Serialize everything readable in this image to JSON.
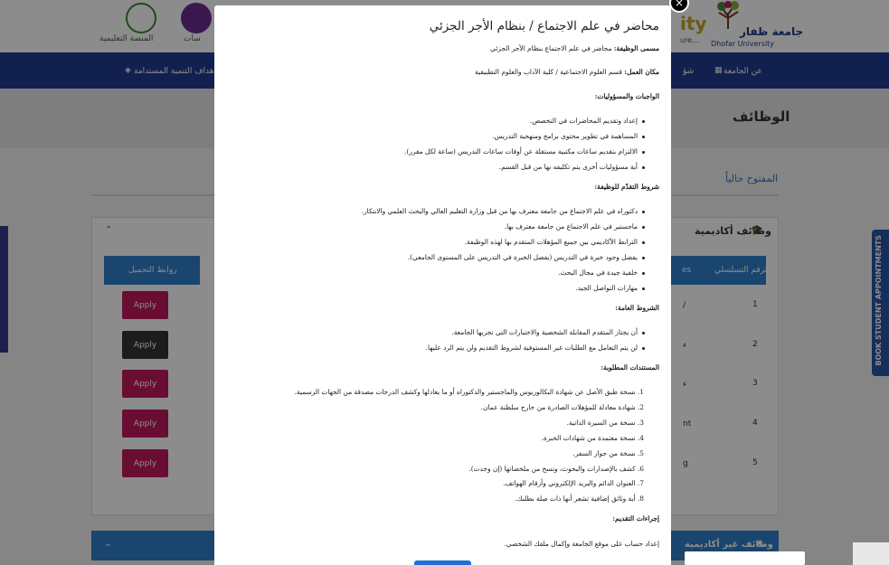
{
  "background": {
    "header": {
      "logo_text_ar": "جامعة ظفار",
      "logo_text_en": "Dhofar University",
      "logo_partial": "ity",
      "logo_partial_sub": "ure...",
      "app1_label": "المنصة التعليمية",
      "app2_label": "سات"
    },
    "nav": {
      "item1": "عن الجامعة",
      "item2": "شؤ",
      "item3": "أهداف التنمية المستدامة"
    },
    "page_title": "الوظائف",
    "open_now": "المفتوح حالياً",
    "panel_title": "وظائف أكاديمية",
    "table_headers": {
      "serial": "الرقم التسلسلي",
      "links": "روابط التحميل",
      "partial": "es"
    },
    "rows": [
      {
        "num": "1",
        "apply": "Apply",
        "frag": "/"
      },
      {
        "num": "2",
        "apply": "Apply",
        "frag": "ء"
      },
      {
        "num": "3",
        "apply": "Apply",
        "frag": "ء"
      },
      {
        "num": "4",
        "apply": "Apply",
        "frag": "nt"
      },
      {
        "num": "5",
        "apply": "Apply",
        "frag": "g"
      }
    ],
    "accordion2": "وظائف غير أكاديمية",
    "side_tab": "BOOK STUDENT APPOINTMENTS",
    "colors": {
      "nav": "#1f3b8f",
      "apply": "#c2185b",
      "apply_active": "#333333",
      "table_head": "#2f7fc8"
    }
  },
  "modal": {
    "title": "محاضر في علم الاجتماع / بنظام الأجر الجزئي",
    "job_title_label": "مسمى الوظيفة:",
    "job_title_value": " محاضر في علم الاجتماع بنظام الأجر الجزئي",
    "workplace_label": "مكان العمل:",
    "workplace_value": " قسم العلوم الاجتماعية / كلية الآداب والعلوم التطبيقية",
    "duties_heading": "الواجبات والمسؤوليات:",
    "duties": [
      "إعداد وتقديم المحاضرات في التخصص.",
      "المساهمة في تطوير محتوى برامج ومنهجية التدريس.",
      "الالتزام بتقديم ساعات مكتبية مستقلة عن أوقات ساعات التدريس (ساعة لكل مقرر).",
      "أية مسؤوليات أخرى يتم تكليفه بها من قبل القسم."
    ],
    "requirements_heading": "شروط التقدّم للوظيفة:",
    "requirements": [
      "دكتوراه في علم الاجتماع من جامعة معترف بها من قبل وزارة التعليم العالي والبحث العلمي والابتكار.",
      "ماجستير في علم الاجتماع من جامعة معترف بها.",
      "الترابط الأكاديمي بين جميع المؤهلات المتقدم بها لهذه الوظيفة.",
      "يفضل وجود خبرة في التدريس (يفضل الخبرة في التدريس على المستوى الجامعي).",
      "خلفية جيدة في مجال البحث.",
      "مهارات التواصل الجيد."
    ],
    "general_heading": "الشروط العامة:",
    "general": [
      "أن يجتاز المتقدم المقابلة الشخصية والاختبارات التي تجريها الجامعة.",
      "لن يتم التعامل مع الطلبات غير المستوفية لشروط التقديم ولن يتم الرد عليها."
    ],
    "documents_heading": "المستندات المطلوبة:",
    "documents": [
      "1. نسخة طبق الأصل عن شهادة البكالوريوس والماجستير والدكتوراه أو ما يعادلها وكشف الدرجات مصدقة من الجهات الرسمية.",
      "2. شهادة معادلة للمؤهلات الصادرة من خارج سلطنة عمان.",
      "3. نسخة من السيرة الذاتية.",
      "4. نسخة معتمدة من شهادات الخبرة.",
      "5. نسخة من جواز السفر.",
      "6. كشف بالإصدارات والبحوث، ونسخ من ملخصاتها (إن وجدت).",
      "7. العنوان الدائم والبريد الإلكتروني وأرقام الهواتف.",
      "8. أية وثائق إضافية تشعر أنها ذات صلة بطلبك."
    ],
    "procedures_heading": "إجراءات التقديم:",
    "procedures_text": "إعداد حساب على موقع الجامعة وإكمال ملفك الشخصي.",
    "close_label": "×"
  }
}
